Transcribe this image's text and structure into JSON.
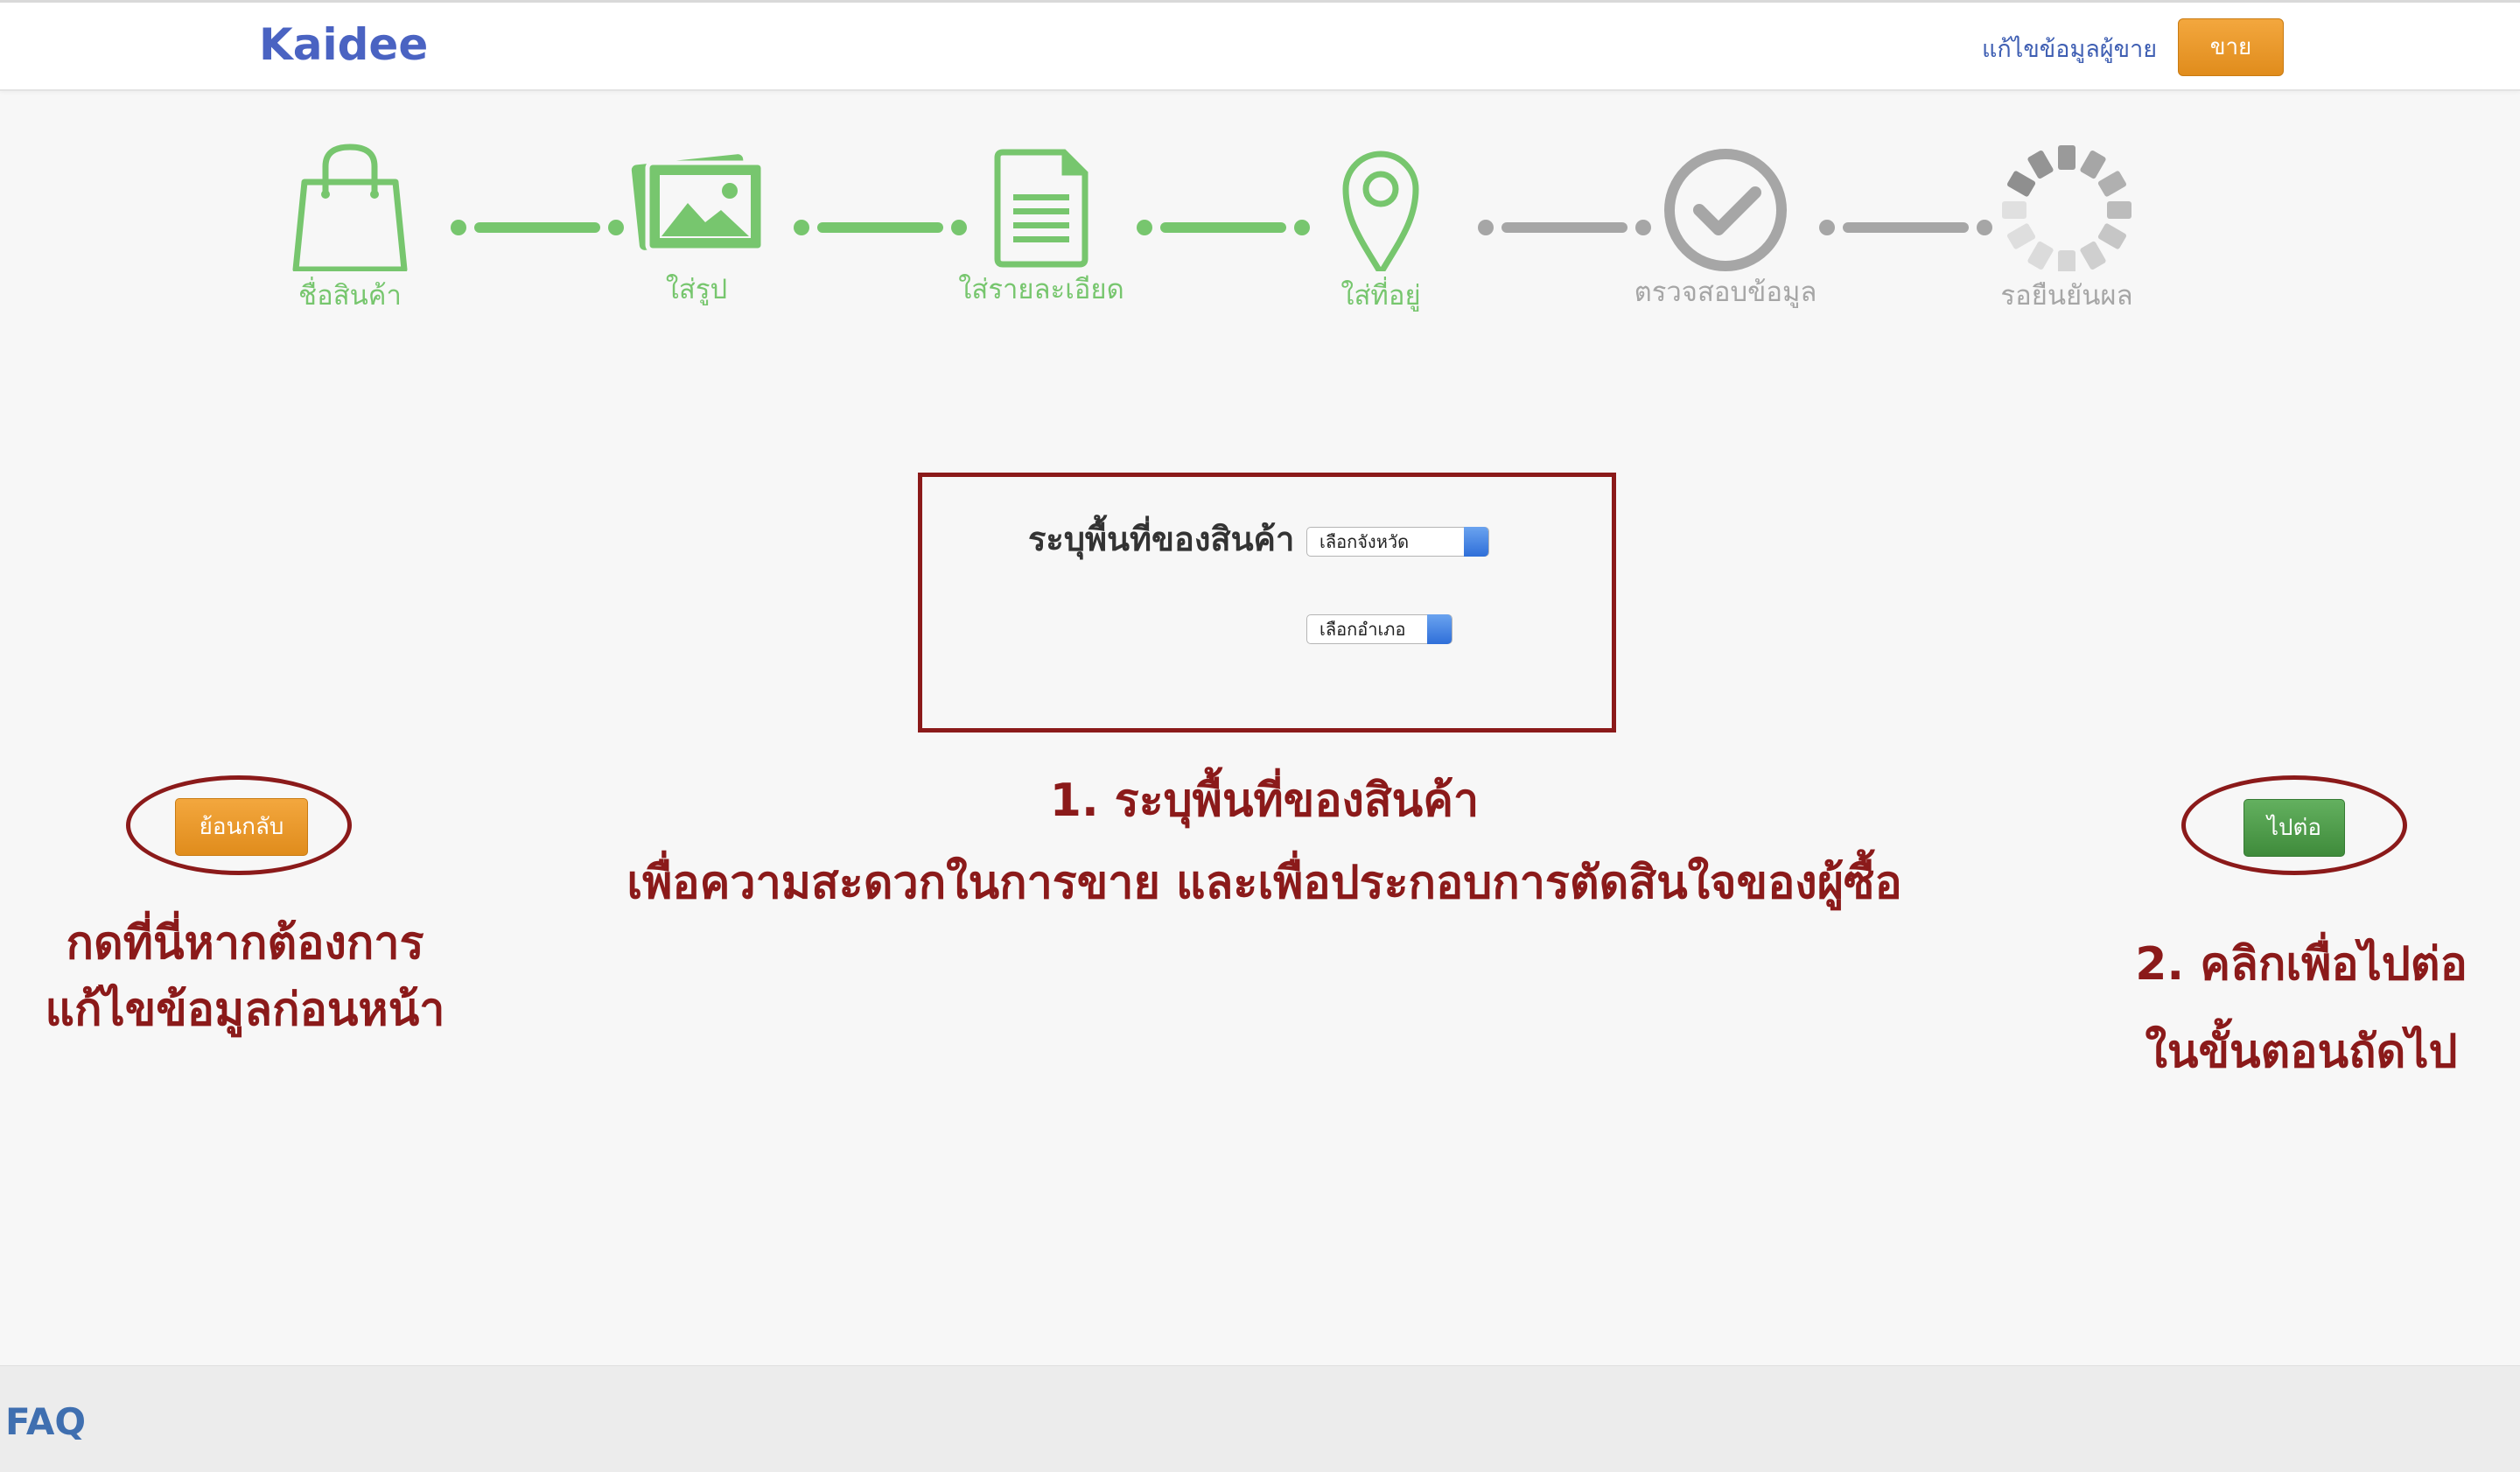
{
  "header": {
    "logo": "Kaidee",
    "seller_link": "แก้ไขข้อมูลผู้ขาย",
    "sell_button": "ขาย"
  },
  "steps": [
    {
      "label": "ชื่อสินค้า",
      "state": "done",
      "icon": "shopping-bag-icon"
    },
    {
      "label": "ใส่รูป",
      "state": "done",
      "icon": "photos-icon"
    },
    {
      "label": "ใส่รายละเอียด",
      "state": "done",
      "icon": "document-icon"
    },
    {
      "label": "ใส่ที่อยู่",
      "state": "current",
      "icon": "location-pin-icon"
    },
    {
      "label": "ตรวจสอบข้อมูล",
      "state": "pending",
      "icon": "check-circle-icon"
    },
    {
      "label": "รอยืนยันผล",
      "state": "pending",
      "icon": "spinner-icon"
    }
  ],
  "colors": {
    "active": "#77c66e",
    "inactive": "#a6a6a6",
    "annotation": "#8b1a1a",
    "brand": "#4a63c2",
    "orange": "#e99a2c",
    "green": "#4c9a48"
  },
  "form": {
    "label": "ระบุพื้นที่ของสินค้า",
    "province_select": "เลือกจังหวัด",
    "district_select": "เลือกอำเภอ"
  },
  "annotations": {
    "center_line1": "1. ระบุพื้นที่ของสินค้า",
    "center_line2": "เพื่อความสะดวกในการขาย  และเพื่อประกอบการตัดสินใจของผู้ซื้อ",
    "left_line1": "กดที่นี่หากต้องการ",
    "left_line2": "แก้ไขข้อมูลก่อนหน้า",
    "right_line1": "2.  คลิกเพื่อไปต่อ",
    "right_line2": "ในขั้นตอนถัดไป"
  },
  "buttons": {
    "back": "ย้อนกลับ",
    "next": "ไปต่อ"
  },
  "footer": {
    "faq": "FAQ"
  }
}
